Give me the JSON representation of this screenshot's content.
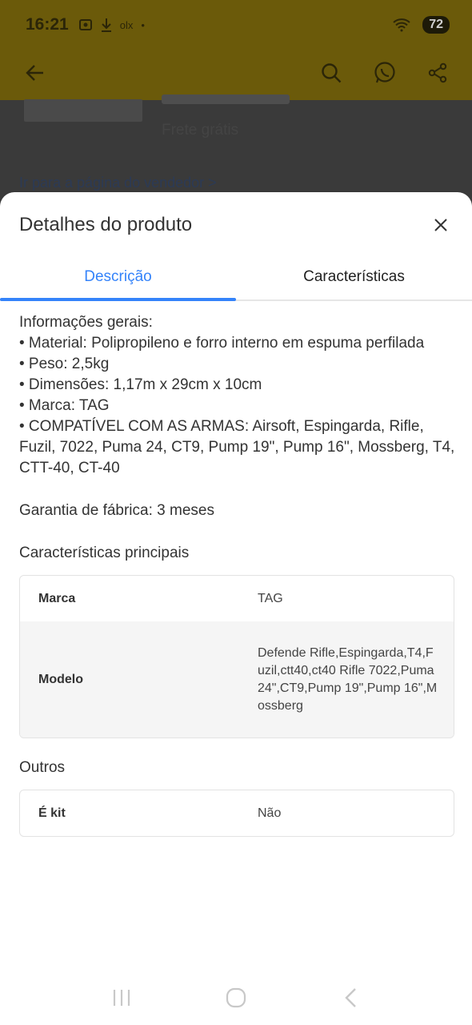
{
  "status_bar": {
    "time": "16:21",
    "notif_label": "olx",
    "battery": "72"
  },
  "background": {
    "shipping_text": "Frete grátis",
    "seller_link": "Ir para a página do vendedor  >"
  },
  "sheet": {
    "title": "Detalhes do produto",
    "tabs": [
      {
        "label": "Descrição",
        "active": true
      },
      {
        "label": "Características",
        "active": false
      }
    ],
    "description_lines": [
      "Informações gerais:",
      "• Material: Polipropileno e forro interno em espuma perfilada",
      "• Peso: 2,5kg",
      "• Dimensões: 1,17m x 29cm x 10cm",
      "• Marca: TAG",
      "• COMPATÍVEL COM AS ARMAS: Airsoft, Espingarda, Rifle, Fuzil, 7022, Puma 24, CT9, Pump 19\", Pump 16\", Mossberg, T4, CTT-40, CT-40"
    ],
    "warranty": "Garantia de fábrica: 3 meses",
    "main_section_title": "Características principais",
    "main_specs": [
      {
        "key": "Marca",
        "value": "TAG"
      },
      {
        "key": "Modelo",
        "value": "Defende Rifle,Espingarda,T4,Fuzil,ctt40,ct40 Rifle 7022,Puma 24\",CT9,Pump 19\",Pump 16\",Mossberg"
      }
    ],
    "other_section_title": "Outros",
    "other_specs": [
      {
        "key": "É kit",
        "value": "Não"
      }
    ]
  },
  "colors": {
    "accent": "#3483fa",
    "header_dimmed": "#6b5a0a"
  },
  "icons": [
    "back-arrow-icon",
    "search-icon",
    "whatsapp-icon",
    "share-icon",
    "close-icon",
    "recent-apps-icon",
    "home-icon",
    "nav-back-icon"
  ]
}
